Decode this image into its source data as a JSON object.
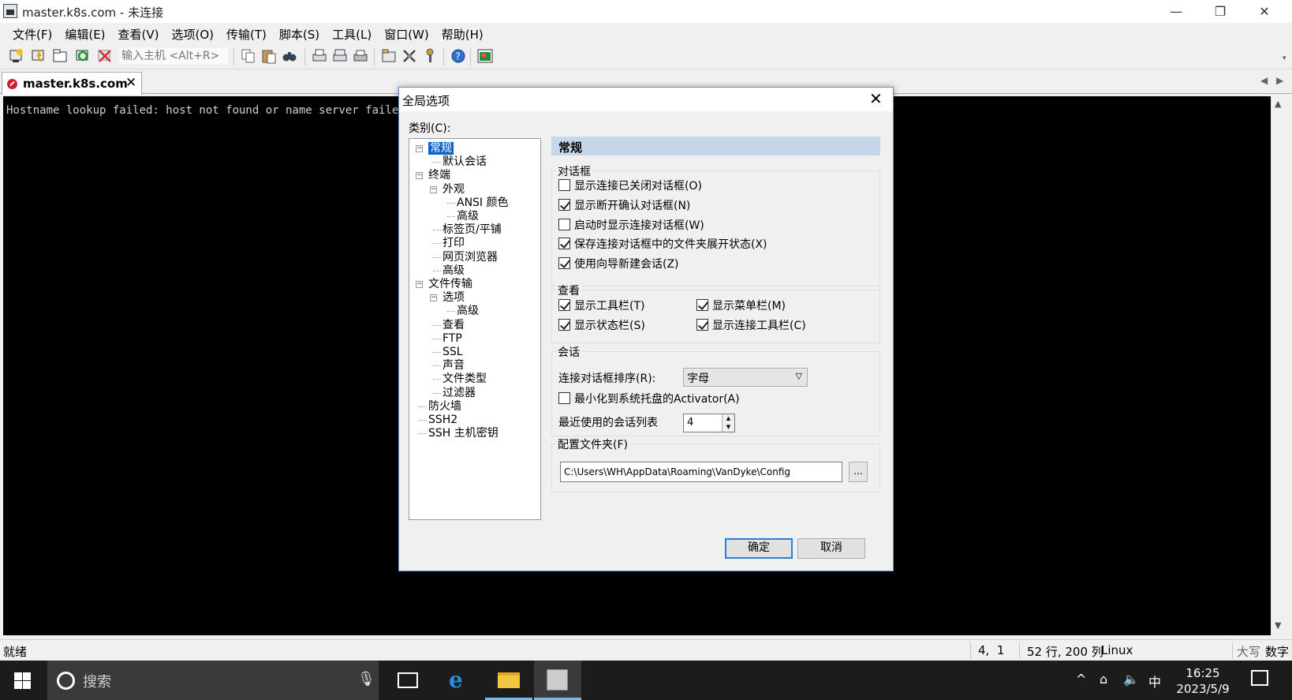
{
  "window": {
    "title": "master.k8s.com - 未连接",
    "controls": {
      "minimize": "—",
      "restore": "❐",
      "close": "✕"
    }
  },
  "menu": [
    "文件(F)",
    "编辑(E)",
    "查看(V)",
    "选项(O)",
    "传输(T)",
    "脚本(S)",
    "工具(L)",
    "窗口(W)",
    "帮助(H)"
  ],
  "toolbar": {
    "host_placeholder": "输入主机 <Alt+R>",
    "icons": [
      "connect-icon",
      "quick-connect-icon",
      "connect-in-tab-icon",
      "reconnect-icon",
      "disconnect-icon",
      "copy-icon",
      "paste-icon",
      "find-icon",
      "print-icon",
      "print-selection-icon",
      "printer-icon",
      "session-options-icon",
      "global-options-icon",
      "keymap-icon",
      "help-icon",
      "sftp-icon"
    ]
  },
  "tab": {
    "label": "master.k8s.com",
    "close": "✕"
  },
  "terminal": {
    "output": "Hostname lookup failed: host not found or name server failed"
  },
  "status": {
    "ready": "就绪",
    "cursor": "4,  1",
    "size": "52 行, 200 列",
    "term": "Linux",
    "caps": "大写",
    "num": "数字"
  },
  "taskbar": {
    "search_placeholder": "搜索",
    "ime": "中",
    "time": "16:25",
    "date": "2023/5/9"
  },
  "dialog": {
    "title": "全局选项",
    "category_label": "类别(C):",
    "tree": [
      {
        "label": "常规",
        "level": 0,
        "expander": "−",
        "selected": true
      },
      {
        "label": "默认会话",
        "level": 1
      },
      {
        "label": "终端",
        "level": 0,
        "expander": "−"
      },
      {
        "label": "外观",
        "level": 1,
        "expander": "−"
      },
      {
        "label": "ANSI 颜色",
        "level": 2
      },
      {
        "label": "高级",
        "level": 2
      },
      {
        "label": "标签页/平铺",
        "level": 1
      },
      {
        "label": "打印",
        "level": 1
      },
      {
        "label": "网页浏览器",
        "level": 1
      },
      {
        "label": "高级",
        "level": 1
      },
      {
        "label": "文件传输",
        "level": 0,
        "expander": "−"
      },
      {
        "label": "选项",
        "level": 1,
        "expander": "−"
      },
      {
        "label": "高级",
        "level": 2
      },
      {
        "label": "查看",
        "level": 1
      },
      {
        "label": "FTP",
        "level": 1
      },
      {
        "label": "SSL",
        "level": 1
      },
      {
        "label": "声音",
        "level": 1
      },
      {
        "label": "文件类型",
        "level": 1
      },
      {
        "label": "过滤器",
        "level": 1
      },
      {
        "label": "防火墙",
        "level": 0
      },
      {
        "label": "SSH2",
        "level": 0
      },
      {
        "label": "SSH 主机密钥",
        "level": 0
      }
    ],
    "section_title": "常规",
    "dialogs_group": {
      "label": "对话框",
      "options": [
        {
          "label": "显示连接已关闭对话框(O)",
          "checked": false
        },
        {
          "label": "显示断开确认对话框(N)",
          "checked": true
        },
        {
          "label": "启动时显示连接对话框(W)",
          "checked": false
        },
        {
          "label": "保存连接对话框中的文件夹展开状态(X)",
          "checked": true
        },
        {
          "label": "使用向导新建会话(Z)",
          "checked": true
        }
      ]
    },
    "view_group": {
      "label": "查看",
      "options": [
        {
          "label": "显示工具栏(T)",
          "checked": true
        },
        {
          "label": "显示菜单栏(M)",
          "checked": true
        },
        {
          "label": "显示状态栏(S)",
          "checked": true
        },
        {
          "label": "显示连接工具栏(C)",
          "checked": true
        }
      ]
    },
    "session_group": {
      "label": "会话",
      "sort_label": "连接对话框排序(R):",
      "sort_value": "字母",
      "minimize_label": "最小化到系统托盘的Activator(A)",
      "minimize_checked": false,
      "recent_label": "最近使用的会话列表",
      "recent_value": "4"
    },
    "config_group": {
      "label": "配置文件夹(F)",
      "path": "C:\\Users\\WH\\AppData\\Roaming\\VanDyke\\Config",
      "browse": "..."
    },
    "ok": "确定",
    "cancel": "取消"
  }
}
